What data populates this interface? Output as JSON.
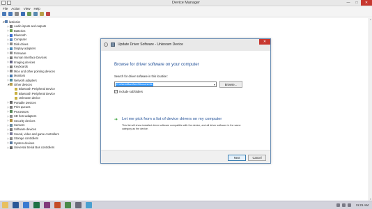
{
  "window": {
    "title": "Device Manager",
    "minimize": "—",
    "maximize": "□",
    "close": "✕"
  },
  "menu": [
    "File",
    "Action",
    "View",
    "Help"
  ],
  "toolbar": [
    {
      "name": "back-icon",
      "color": "#4a7ab8"
    },
    {
      "name": "forward-icon",
      "color": "#4a7ab8"
    },
    {
      "name": "properties-icon",
      "color": "#8a8a8a"
    },
    {
      "name": "help-icon",
      "color": "#3d6fb5"
    },
    {
      "name": "scan-hardware-icon",
      "color": "#6a9a5a"
    },
    {
      "name": "update-driver-icon",
      "color": "#5a8ab0"
    },
    {
      "name": "enable-device-icon",
      "color": "#b8a04a"
    },
    {
      "name": "uninstall-icon",
      "color": "#c04848"
    }
  ],
  "tree": [
    {
      "label": "lusticsict",
      "arrow": "◢",
      "level": 0,
      "icon_color": "#5a7fb0"
    },
    {
      "label": "Audio inputs and outputs",
      "arrow": "▷",
      "level": 1,
      "icon_color": "#7a7a7a"
    },
    {
      "label": "Batteries",
      "arrow": "▷",
      "level": 1,
      "icon_color": "#6aa050"
    },
    {
      "label": "Bluetooth",
      "arrow": "▷",
      "level": 1,
      "icon_color": "#3d6fd0"
    },
    {
      "label": "Computer",
      "arrow": "▷",
      "level": 1,
      "icon_color": "#5a8ac0"
    },
    {
      "label": "Disk drives",
      "arrow": "▷",
      "level": 1,
      "icon_color": "#8a8a8a"
    },
    {
      "label": "Display adapters",
      "arrow": "▷",
      "level": 1,
      "icon_color": "#4a8ab8"
    },
    {
      "label": "Firmware",
      "arrow": "▷",
      "level": 1,
      "icon_color": "#8a8a8a"
    },
    {
      "label": "Human Interface Devices",
      "arrow": "▷",
      "level": 1,
      "icon_color": "#7a7a7a"
    },
    {
      "label": "Imaging devices",
      "arrow": "▷",
      "level": 1,
      "icon_color": "#6a6a8a"
    },
    {
      "label": "Keyboards",
      "arrow": "▷",
      "level": 1,
      "icon_color": "#7a7a7a"
    },
    {
      "label": "Mice and other pointing devices",
      "arrow": "▷",
      "level": 1,
      "icon_color": "#7a7a7a"
    },
    {
      "label": "Monitors",
      "arrow": "▷",
      "level": 1,
      "icon_color": "#4a7ab0"
    },
    {
      "label": "Network adapters",
      "arrow": "▷",
      "level": 1,
      "icon_color": "#4a8a9a"
    },
    {
      "label": "Other devices",
      "arrow": "◢",
      "level": 1,
      "icon_color": "#b8a050"
    },
    {
      "label": "Bluetooth Peripheral Device",
      "arrow": "",
      "level": 2,
      "icon_color": "#c8b040"
    },
    {
      "label": "Bluetooth Peripheral Device",
      "arrow": "",
      "level": 2,
      "icon_color": "#c8b040"
    },
    {
      "label": "Unknown device",
      "arrow": "",
      "level": 2,
      "icon_color": "#c8b040"
    },
    {
      "label": "Portable Devices",
      "arrow": "▷",
      "level": 1,
      "icon_color": "#6a6a6a"
    },
    {
      "label": "Print queues",
      "arrow": "▷",
      "level": 1,
      "icon_color": "#7a7a7a"
    },
    {
      "label": "Processors",
      "arrow": "▷",
      "level": 1,
      "icon_color": "#5a8a5a"
    },
    {
      "label": "SD host adapters",
      "arrow": "▷",
      "level": 1,
      "icon_color": "#8a8a8a"
    },
    {
      "label": "Security devices",
      "arrow": "▷",
      "level": 1,
      "icon_color": "#b09040"
    },
    {
      "label": "Sensors",
      "arrow": "▷",
      "level": 1,
      "icon_color": "#6a8aa0"
    },
    {
      "label": "Software devices",
      "arrow": "▷",
      "level": 1,
      "icon_color": "#7a7a7a"
    },
    {
      "label": "Sound, video and game controllers",
      "arrow": "▷",
      "level": 1,
      "icon_color": "#7a7a9a"
    },
    {
      "label": "Storage controllers",
      "arrow": "▷",
      "level": 1,
      "icon_color": "#8a8a8a"
    },
    {
      "label": "System devices",
      "arrow": "▷",
      "level": 1,
      "icon_color": "#5a7aa0"
    },
    {
      "label": "Universal Serial Bus controllers",
      "arrow": "▷",
      "level": 1,
      "icon_color": "#6a6a6a"
    }
  ],
  "dialog": {
    "title": "Update Driver Software - Unknown Device",
    "back": "←",
    "close": "✕",
    "heading": "Browse for driver software on your computer",
    "search_label": "Search for driver software in this location:",
    "path_value": "C:\\Users\\Bad\\Neel\\Documents",
    "dropdown_glyph": "▾",
    "browse_label": "Browse...",
    "checkbox_checked": true,
    "checkbox_glyph": "✓",
    "checkbox_label": "Include subfolders",
    "pick_arrow": "➔",
    "pick_label": "Let me pick from a list of device drivers on my computer",
    "pick_desc": "This list will show installed driver software compatible with the device, and all driver software in the same category as the device.",
    "next_label": "Next",
    "cancel_label": "Cancel"
  },
  "taskbar": {
    "apps": [
      {
        "name": "explorer-icon",
        "color": "#e8c060"
      },
      {
        "name": "word-icon",
        "color": "#2b5797"
      },
      {
        "name": "mail-icon",
        "color": "#3a7ad0"
      },
      {
        "name": "excel-icon",
        "color": "#1e7145"
      },
      {
        "name": "onenote-icon",
        "color": "#80397b"
      },
      {
        "name": "powerpoint-icon",
        "color": "#c44d28"
      },
      {
        "name": "store-icon",
        "color": "#4a8a4a"
      },
      {
        "name": "settings-icon",
        "color": "#6a6a7a"
      },
      {
        "name": "photos-icon",
        "color": "#4aa0d0"
      }
    ],
    "time": "11:21 AM"
  },
  "scrollbar": {
    "up": "▲",
    "down": "▼"
  }
}
